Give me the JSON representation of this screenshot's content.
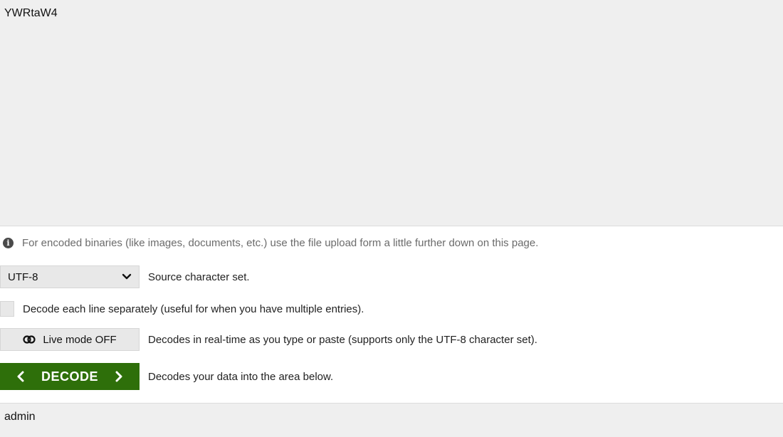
{
  "input": {
    "value": "YWRtaW4"
  },
  "note": {
    "text": "For encoded binaries (like images, documents, etc.) use the file upload form a little further down on this page.",
    "icon": "info-icon"
  },
  "charset": {
    "selected": "UTF-8",
    "description": "Source character set."
  },
  "separate_lines": {
    "checked": false,
    "label": "Decode each line separately (useful for when you have multiple entries)."
  },
  "live_mode": {
    "label": "Live mode OFF",
    "description": "Decodes in real-time as you type or paste (supports only the UTF-8 character set).",
    "icon": "toggle-icon"
  },
  "decode": {
    "label": "DECODE",
    "description": "Decodes your data into the area below.",
    "color": "#2e6f0a"
  },
  "output": {
    "value": "admin"
  }
}
